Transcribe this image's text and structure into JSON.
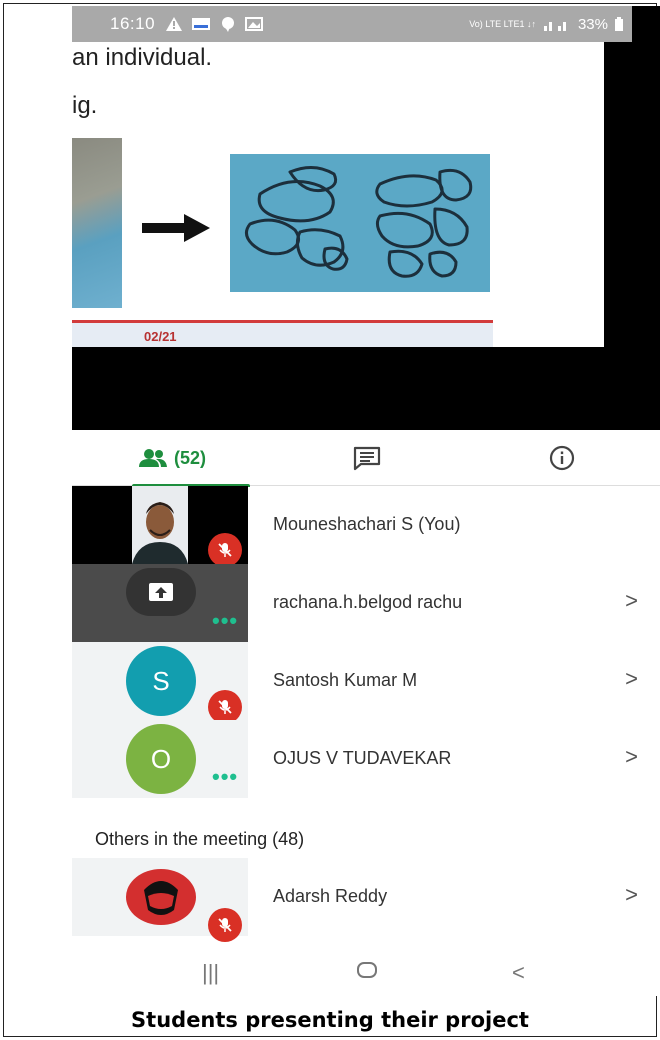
{
  "status_bar": {
    "time": "16:10",
    "network": "Vo) LTE LTE1 ↓↑",
    "battery": "33%"
  },
  "slide": {
    "text_line1": "an individual.",
    "text_line2": "ig.",
    "page_number": "02/21"
  },
  "tabs": {
    "people_count": "(52)",
    "chat_label": "",
    "info_label": ""
  },
  "participants": [
    {
      "name": "Mouneshachari S (You)",
      "avatar_letter": "",
      "muted": true
    },
    {
      "name": "rachana.h.belgod rachu",
      "avatar_letter": "",
      "muted": false
    },
    {
      "name": "Santosh Kumar M",
      "avatar_letter": "S",
      "muted": true,
      "color": "#129eaf"
    },
    {
      "name": "OJUS V TUDAVEKAR",
      "avatar_letter": "O",
      "muted": false,
      "color": "#7cb342"
    }
  ],
  "others_header": "Others in the meeting (48)",
  "others": [
    {
      "name": "Adarsh Reddy",
      "muted": true
    }
  ],
  "nav": {
    "recent": "|||",
    "home": "◯",
    "back": "<"
  },
  "caption": "Students presenting their project",
  "colors": {
    "accent_green": "#1e8e3e",
    "mute_red": "#d93025",
    "dots_teal": "#1fbf8f"
  }
}
